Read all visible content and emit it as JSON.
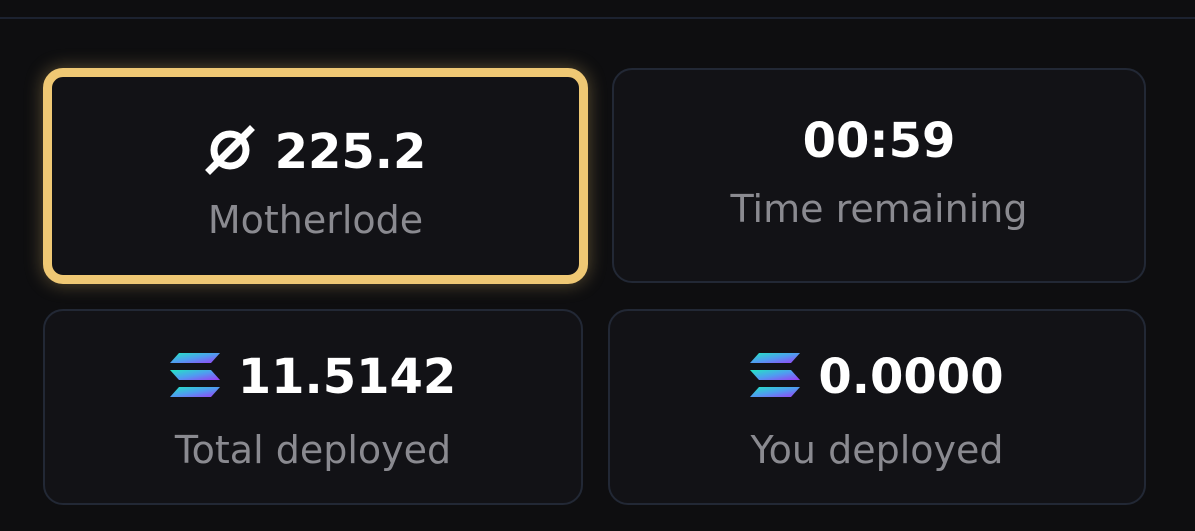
{
  "cards": [
    {
      "value": "225.2",
      "label": "Motherlode",
      "icon": "motherlode-icon",
      "highlighted": true
    },
    {
      "value": "00:59",
      "label": "Time remaining"
    },
    {
      "value": "11.5142",
      "label": "Total deployed",
      "icon": "solana-icon"
    },
    {
      "value": "0.0000",
      "label": "You deployed",
      "icon": "solana-icon"
    }
  ],
  "colors": {
    "background": "#0e0e10",
    "card": "#121216",
    "card_border": "#222835",
    "highlight": "#efc874",
    "label": "#8a8a90"
  }
}
